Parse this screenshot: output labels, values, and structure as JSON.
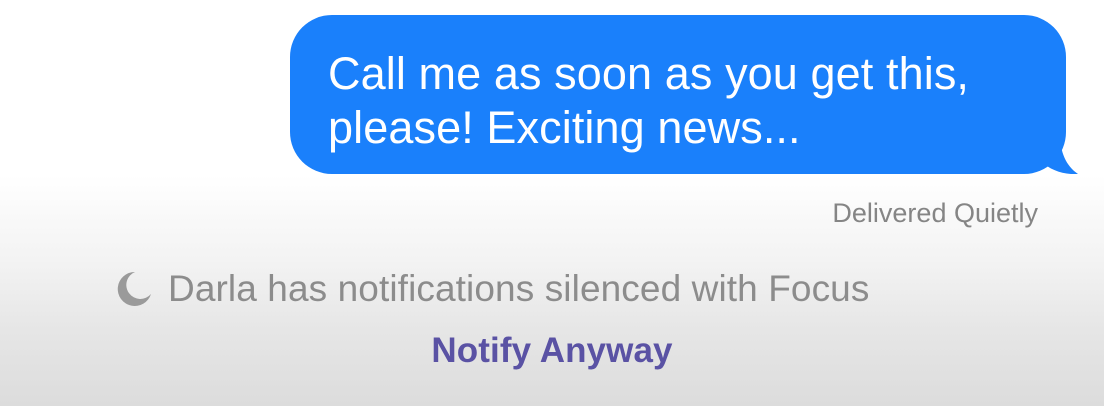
{
  "message": {
    "text_line1": "Call me as soon as you get this,",
    "text_line2": "please! Exciting news...",
    "status": "Delivered Quietly",
    "bubble_color": "#1a80fb"
  },
  "focus": {
    "icon": "moon-icon",
    "notice": "Darla has notifications silenced with Focus",
    "action_label": "Notify Anyway",
    "action_color": "#5a52a4"
  }
}
